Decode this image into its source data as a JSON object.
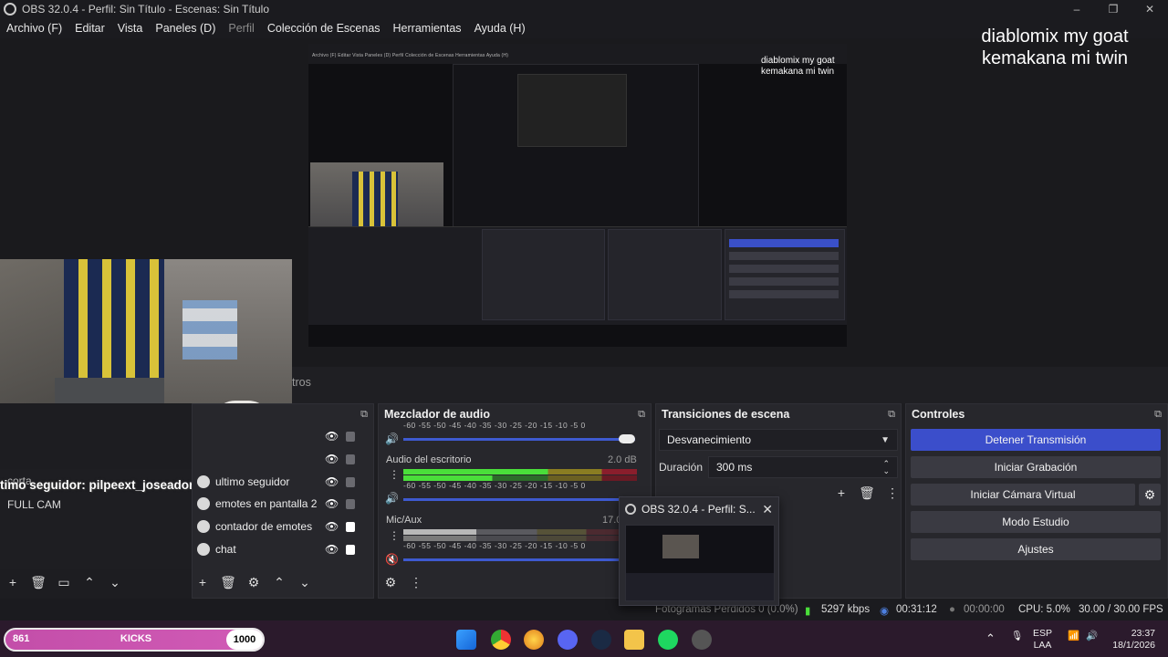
{
  "window": {
    "title": "OBS 32.0.4 - Perfil: Sin Título - Escenas: Sin Título",
    "min": "–",
    "max": "❐",
    "close": "✕"
  },
  "menu": [
    "Archivo (F)",
    "Editar",
    "Vista",
    "Paneles (D)",
    "Perfil",
    "Colección de Escenas",
    "Herramientas",
    "Ayuda (H)"
  ],
  "overlay_text": [
    "diablomix my goat",
    "kemakana mi twin"
  ],
  "nested_preview": {
    "overlay_text": [
      "diablomix my goat",
      "kemakana mi twin"
    ],
    "menu": "Archivo (F)   Editar   Vista   Paneles (D)   Perfil   Colección de Escenas   Herramientas   Ayuda (H)"
  },
  "hidden_tab_fragment": "tros",
  "scenes": {
    "title": "",
    "overlay": "timo seguidor: pilpeext_joseador",
    "cam_label": "FULL CAM",
    "partial_label": "corta"
  },
  "sources": {
    "items": [
      {
        "name": "ultimo seguidor",
        "locked": false
      },
      {
        "name": "emotes en pantalla 2",
        "locked": false
      },
      {
        "name": "contador de emotes",
        "locked": true
      },
      {
        "name": "chat",
        "locked": true
      }
    ]
  },
  "mixer": {
    "title": "Mezclador de audio",
    "scale": "-60  -55  -50  -45  -40  -35  -30  -25  -20  -15  -10   -5    0",
    "channels": [
      {
        "name": "Audio del escritorio",
        "db": "2.0 dB"
      },
      {
        "name": "Mic/Aux",
        "db": "17.0"
      }
    ]
  },
  "transitions": {
    "title": "Transiciones de escena",
    "selected": "Desvanecimiento",
    "duration_label": "Duración",
    "duration_value": "300 ms"
  },
  "controls": {
    "title": "Controles",
    "buttons": [
      "Detener Transmisión",
      "Iniciar Grabación",
      "Iniciar Cámara Virtual",
      "Modo Estudio",
      "Ajustes"
    ]
  },
  "popup": {
    "title": "OBS 32.0.4 - Perfil: S..."
  },
  "status": {
    "dropped": "Fotogramas Perdidos 0 (0.0%)",
    "bitrate": "5297 kbps",
    "stream_time": "00:31:12",
    "rec_time": "00:00:00",
    "cpu": "CPU: 5.0%",
    "fps": "30.00 / 30.00 FPS"
  },
  "kicks": {
    "left": "861",
    "label": "KICKS",
    "right": "1000"
  },
  "tray": {
    "lang": "ESP",
    "layout": "LAA",
    "time": "23:37",
    "date": "18/1/2026",
    "chevron": "⌃"
  },
  "colors": {
    "accent": "#3b4ecb",
    "panel": "#27272c",
    "meter_green": "#4ade3a",
    "meter_yellow": "#b8a534",
    "meter_red": "#b02a3a"
  }
}
